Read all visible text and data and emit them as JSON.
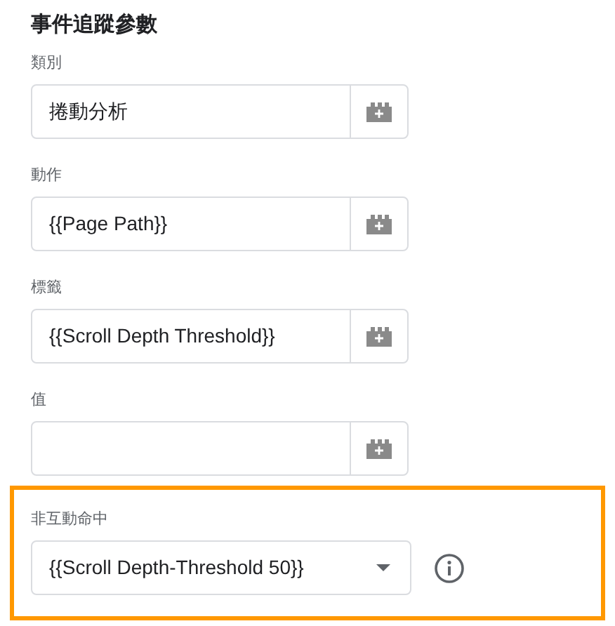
{
  "title": "事件追蹤參數",
  "fields": [
    {
      "kind": "variable",
      "label": "類別",
      "value": "捲動分析"
    },
    {
      "kind": "variable",
      "label": "動作",
      "value": "{{Page Path}}"
    },
    {
      "kind": "variable",
      "label": "標籤",
      "value": "{{Scroll Depth Threshold}}"
    },
    {
      "kind": "variable",
      "label": "值"
    }
  ],
  "highlighted_field": {
    "kind": "select",
    "label": "非互動命中",
    "value": "{{Scroll Depth-Threshold 50}}"
  }
}
